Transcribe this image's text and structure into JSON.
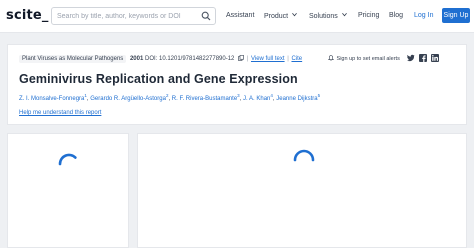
{
  "header": {
    "logo": "scite_",
    "search_placeholder": "Search by title, author, keywords or DOI",
    "nav": [
      {
        "label": "Assistant",
        "has_dropdown": false
      },
      {
        "label": "Product",
        "has_dropdown": true
      },
      {
        "label": "Solutions",
        "has_dropdown": true
      },
      {
        "label": "Pricing",
        "has_dropdown": false
      },
      {
        "label": "Blog",
        "has_dropdown": false
      }
    ],
    "login": "Log In",
    "signup": "Sign Up"
  },
  "paper": {
    "journal": "Plant Viruses as Molecular Pathogens",
    "year": "2001",
    "doi": "DOI: 10.1201/9781482277890-12",
    "view_full_text": "View full text",
    "separator": "|",
    "cite": "Cite",
    "alert_text": "Sign up to set email alerts",
    "title": "Geminivirus Replication and Gene Expression",
    "authors": [
      {
        "name": "Z. I. Monsalve-Fonnegra",
        "sup": "1"
      },
      {
        "name": "Gerardo R. Argüello-Astorga",
        "sup": "2"
      },
      {
        "name": "R. F. Rivera-Bustamante",
        "sup": "3"
      },
      {
        "name": "J. A. Khan",
        "sup": "4"
      },
      {
        "name": "Jeanne Dijkstra",
        "sup": "5"
      }
    ],
    "help_link": "Help me understand this report"
  },
  "colors": {
    "accent": "#1f6fd1",
    "background": "#eef0f3",
    "card": "#ffffff"
  },
  "icons": {
    "search": "search-icon",
    "copy": "copy-icon",
    "bell": "bell-icon",
    "twitter": "twitter-icon",
    "facebook": "facebook-icon",
    "linkedin": "linkedin-icon",
    "loading": "loading-spinner-icon"
  }
}
